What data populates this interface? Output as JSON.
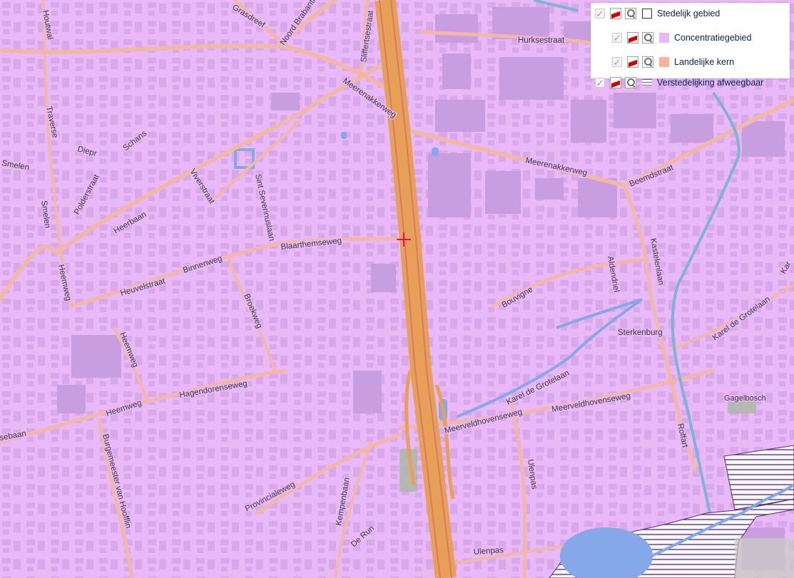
{
  "colors": {
    "map_background": "#e9b8f6",
    "building": "#c89ee0",
    "road": "#f2b8a6",
    "highway": "#e8a057",
    "water": "#86a8e8",
    "border_line": "#7fb3d6",
    "green_area": "#a7b8a2",
    "hatch": "#5a2a6a"
  },
  "legend": {
    "items": [
      {
        "label": "Stedelijk gebied",
        "swatch_color": "#ffffff",
        "swatch_type": "box",
        "icons": [
          "checkbox-icon",
          "style-icon",
          "zoom-icon"
        ]
      },
      {
        "label": "Concentratiegebied",
        "swatch_color": "#e9b8f6",
        "swatch_type": "fill",
        "icons": [
          "checkbox-icon",
          "style-icon",
          "zoom-icon"
        ]
      },
      {
        "label": "Landelijke kern",
        "swatch_color": "#f7b49b",
        "swatch_type": "fill",
        "icons": [
          "checkbox-icon",
          "style-icon",
          "zoom-icon"
        ]
      },
      {
        "label": "Verstedelijking afweegbaar",
        "swatch_color": "#8a4aaa",
        "swatch_type": "lines",
        "icons": [
          "checkbox-icon",
          "style-icon",
          "zoom-icon"
        ]
      }
    ]
  },
  "map_labels": {
    "houtwal": "Houtwal",
    "grasdreef": "Grasdreef",
    "noord_brabantlaan": "Noord Brabantl",
    "slifferstestraat": "Sliffertsestraat",
    "hurksestraat": "Hurksestraat",
    "meerenakkerweg_1": "Meerenakkerweg",
    "meerenakkerweg_2": "Meerenakkerweg",
    "traverse": "Traverse",
    "diepr": "Diepr",
    "schans": "Schans",
    "smelen": "Smelen",
    "polderstraat": "Polderstraat",
    "smelen_2": "Smelen",
    "viverstraat": "Viverstraat",
    "sint_severinuslaan": "Sint Severinuslaan",
    "heerbaan": "Heerbaan",
    "blaarthemseweg": "Blaarthemseweg",
    "beemdstraat": "Beemdstraat",
    "heemweg_1": "Heemweg",
    "binnenweg": "Binnenweg",
    "heuvelstraat": "Heuvelstraat",
    "broekweg": "Broekweg",
    "bouvigne": "Bouvigne",
    "aldendriel": "Aldendriel",
    "kastelenlaan": "Kastelenlaan",
    "sterkenburg": "Sterkenburg",
    "karel_de_grotelaan_1": "Karel de Grotelaan",
    "karel_de_grotelaan_2": "Karel de Grotelaan",
    "heemweg_2": "Heemweg",
    "hagendorenseweg": "Hagendorenseweg",
    "meerveldhovenseweg_1": "Meerveldhovenseweg",
    "meerveldhovenseweg_2": "Meerveldhovenseweg",
    "gagelbosch": "Gagelbosch",
    "heemweg_3": "Heemweg",
    "sebaan": "sebaan",
    "burgemeester_van_hooffln": "Burgemeester van Hoofflin",
    "provincialeweg": "Provincialeweg",
    "kempenbaan": "Kempenbaan",
    "ulenpas_1": "Ulenpas",
    "roffart": "Roffart",
    "de_run": "De Run",
    "ulenpas_2": "Ulenpas",
    "kar": "Kar"
  }
}
